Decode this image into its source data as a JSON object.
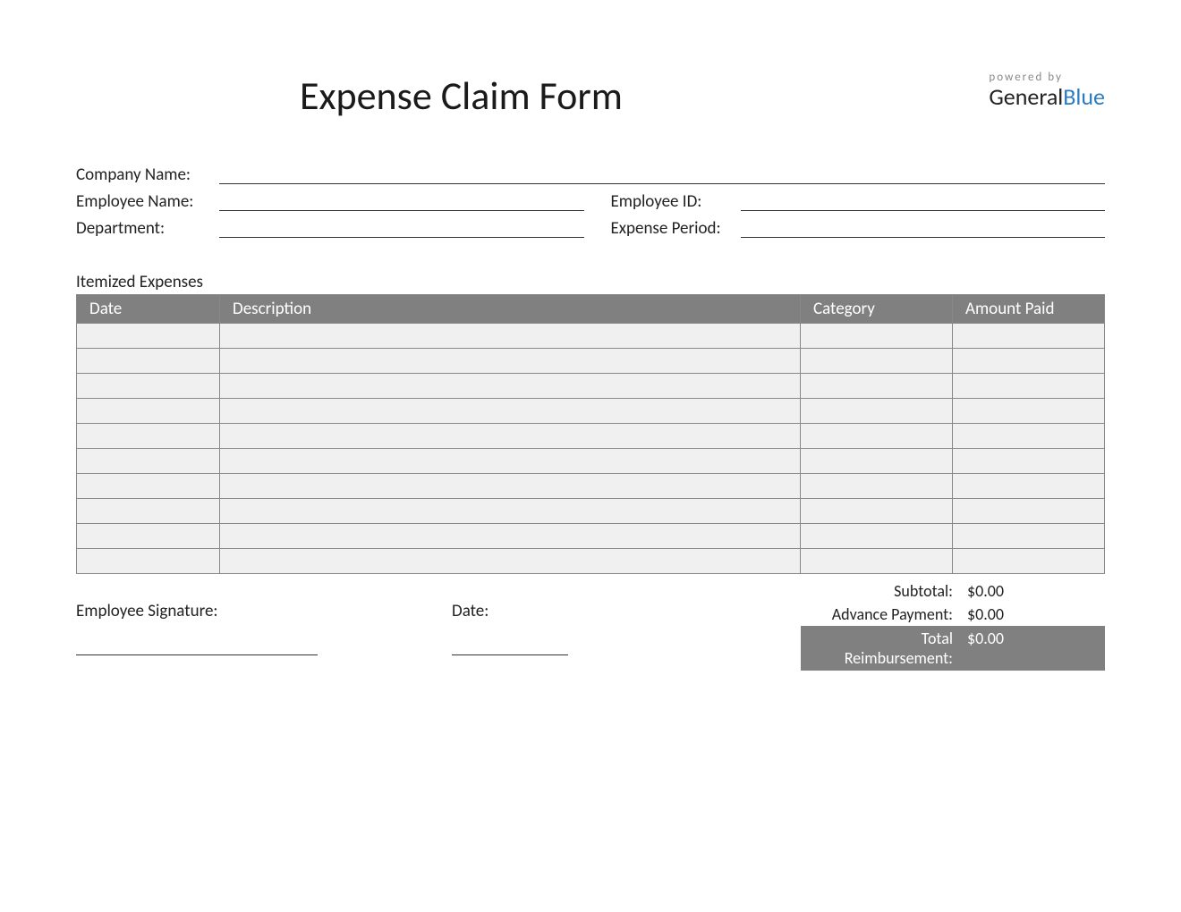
{
  "form": {
    "title": "Expense Claim Form",
    "powered_by_label": "powered by",
    "brand_part1": "General",
    "brand_part2": "Blue"
  },
  "info": {
    "company_label": "Company Name:",
    "employee_label": "Employee Name:",
    "employee_id_label": "Employee ID:",
    "department_label": "Department:",
    "expense_period_label": "Expense Period:",
    "company_value": "",
    "employee_value": "",
    "employee_id_value": "",
    "department_value": "",
    "expense_period_value": ""
  },
  "itemized": {
    "section_title": "Itemized Expenses",
    "headers": {
      "date": "Date",
      "description": "Description",
      "category": "Category",
      "amount": "Amount Paid"
    },
    "rows": [
      {
        "date": "",
        "description": "",
        "category": "",
        "amount": ""
      },
      {
        "date": "",
        "description": "",
        "category": "",
        "amount": ""
      },
      {
        "date": "",
        "description": "",
        "category": "",
        "amount": ""
      },
      {
        "date": "",
        "description": "",
        "category": "",
        "amount": ""
      },
      {
        "date": "",
        "description": "",
        "category": "",
        "amount": ""
      },
      {
        "date": "",
        "description": "",
        "category": "",
        "amount": ""
      },
      {
        "date": "",
        "description": "",
        "category": "",
        "amount": ""
      },
      {
        "date": "",
        "description": "",
        "category": "",
        "amount": ""
      },
      {
        "date": "",
        "description": "",
        "category": "",
        "amount": ""
      },
      {
        "date": "",
        "description": "",
        "category": "",
        "amount": ""
      }
    ]
  },
  "signature": {
    "employee_sig_label": "Employee Signature:",
    "date_label": "Date:"
  },
  "totals": {
    "subtotal_label": "Subtotal:",
    "subtotal_value": "$0.00",
    "advance_label": "Advance Payment:",
    "advance_value": "$0.00",
    "total_label": "Total Reimbursement:",
    "total_value": "$0.00"
  }
}
